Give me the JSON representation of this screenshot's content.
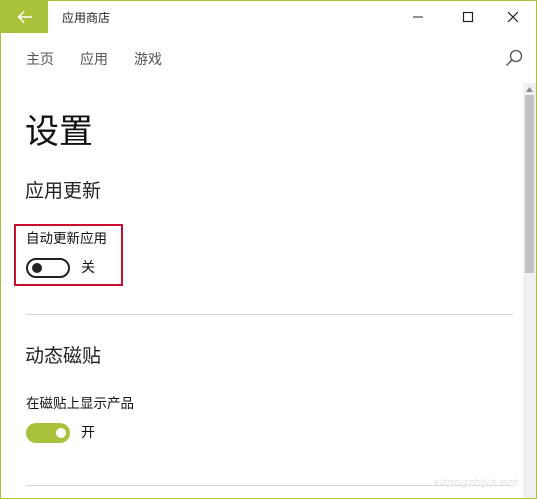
{
  "window": {
    "title": "应用商店"
  },
  "nav": {
    "items": [
      "主页",
      "应用",
      "游戏"
    ]
  },
  "page": {
    "title": "设置"
  },
  "sections": {
    "app_updates": {
      "title": "应用更新",
      "auto_update_label": "自动更新应用",
      "auto_update_state": "关",
      "auto_update_on": false
    },
    "live_tiles": {
      "title": "动态磁贴",
      "show_on_tile_label": "在磁贴上显示产品",
      "show_on_tile_state": "开",
      "show_on_tile_on": true
    }
  },
  "watermark": "xitongzhijia.net",
  "colors": {
    "accent": "#a8c23c",
    "highlight_border": "#c8102e"
  },
  "icons": [
    "back-arrow-icon",
    "minimize-icon",
    "maximize-icon",
    "close-icon",
    "search-icon",
    "scroll-up-arrow-icon"
  ]
}
